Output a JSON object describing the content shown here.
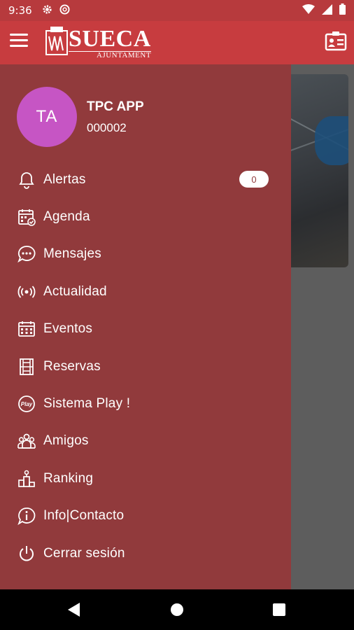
{
  "status_bar": {
    "time": "9:36",
    "icons": [
      "gear-icon",
      "at-sign-icon",
      "wifi-icon",
      "signal-icon",
      "battery-icon"
    ]
  },
  "app_bar": {
    "logo_text": "SUECA",
    "logo_subtext": "AJUNTAMENT",
    "menu_icon": "hamburger-menu-icon",
    "right_icon": "id-card-icon"
  },
  "profile": {
    "initials": "TA",
    "name": "TPC APP",
    "code": "000002",
    "avatar_color": "#c655c4"
  },
  "menu": {
    "items": [
      {
        "label": "Alertas",
        "icon": "bell-icon",
        "badge": "0"
      },
      {
        "label": "Agenda",
        "icon": "calendar-check-icon"
      },
      {
        "label": "Mensajes",
        "icon": "chat-bubble-icon"
      },
      {
        "label": "Actualidad",
        "icon": "broadcast-icon"
      },
      {
        "label": "Eventos",
        "icon": "calendar-grid-icon"
      },
      {
        "label": "Reservas",
        "icon": "court-icon"
      },
      {
        "label": "Sistema Play !",
        "icon": "play-badge-icon"
      },
      {
        "label": "Amigos",
        "icon": "people-icon"
      },
      {
        "label": "Ranking",
        "icon": "podium-icon"
      },
      {
        "label": "Info|Contacto",
        "icon": "info-icon"
      },
      {
        "label": "Cerrar sesión",
        "icon": "power-icon"
      }
    ]
  },
  "colors": {
    "status_bar": "#b73a3d",
    "app_bar": "#c73c3f",
    "drawer": "#913a3c",
    "scrim": "#5d5d5d"
  },
  "nav_bar": {
    "icons": [
      "back-triangle-icon",
      "home-circle-icon",
      "recents-square-icon"
    ]
  }
}
